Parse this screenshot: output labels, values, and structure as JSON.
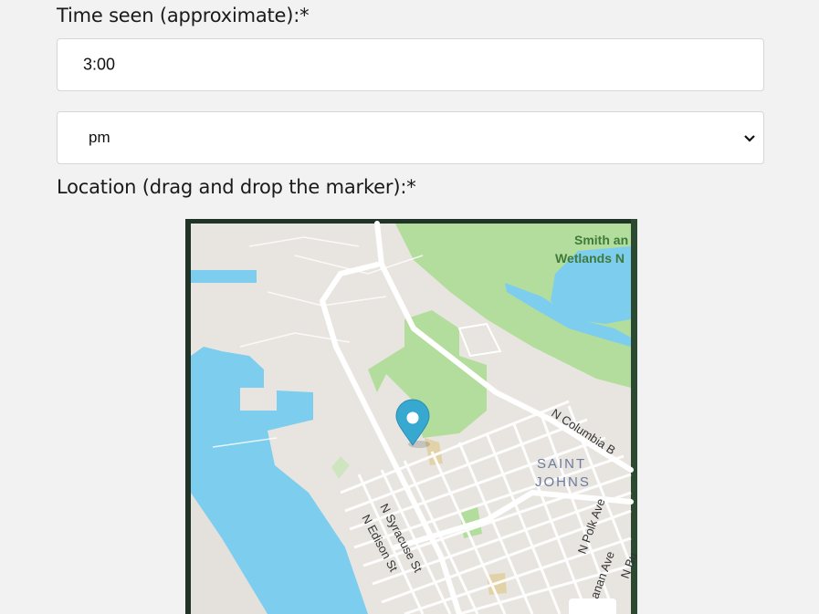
{
  "form": {
    "time_label": "Time seen (approximate):*",
    "time_value": "3:00",
    "ampm_value": "pm",
    "location_label": "Location (drag and drop the marker):*"
  },
  "map": {
    "labels": {
      "park_line1": "Smith an",
      "park_line2": "Wetlands N",
      "columbia": "N Columbia B",
      "saint": "SAINT",
      "johns": "JOHNS",
      "syracuse": "N Syracuse St",
      "edison": "N Edison St",
      "polk": "N Polk Ave",
      "buchanan": "chanan Ave",
      "bu": "N Bu"
    },
    "colors": {
      "water": "#7dcdef",
      "land": "#e8e5e0",
      "park": "#b3dd9c",
      "marker": "#37a8cf"
    }
  }
}
